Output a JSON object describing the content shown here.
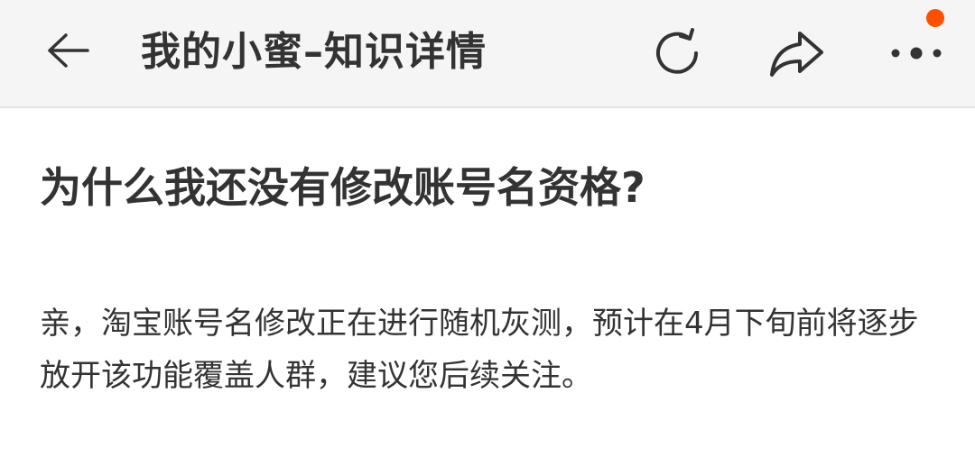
{
  "header": {
    "title": "我的小蜜–知识详情",
    "icons": {
      "back": "back-arrow-icon",
      "refresh": "refresh-icon",
      "share": "share-icon",
      "more": "more-icon"
    },
    "badge_color": "#ff5000"
  },
  "article": {
    "question": "为什么我还没有修改账号名资格?",
    "answer": "亲，淘宝账号名修改正在进行随机灰测，预计在4月下旬前将逐步放开该功能覆盖人群，建议您后续关注。"
  }
}
